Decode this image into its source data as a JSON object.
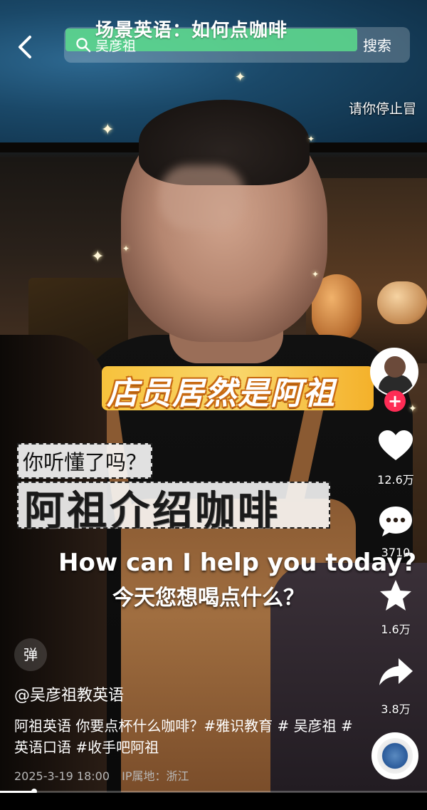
{
  "top": {
    "video_title": "场景英语：如何点咖啡",
    "search_query": "吴彦祖",
    "search_button": "搜索",
    "ticker_text": "请你停止冒"
  },
  "overlay": {
    "banner": "店员居然是阿祖",
    "caption_small": "你听懂了吗？",
    "caption_large": "阿祖介绍咖啡",
    "subtitle_en": "How can I help you today?",
    "subtitle_zh": "今天您想喝点什么？"
  },
  "actions": {
    "follow_symbol": "+",
    "likes": "12.6万",
    "comments": "3710",
    "favorites": "1.6万",
    "shares": "3.8万"
  },
  "info": {
    "danmu_label": "弹",
    "author": "@吴彦祖教英语",
    "description": "阿祖英语 你要点杯什么咖啡？#雅识教育 # 吴彦祖 #英语口语 #收手吧阿祖",
    "date": "2025-3-19 18:00",
    "ip_location": "IP属地：浙江"
  },
  "playback": {
    "progress_fraction": 0.08
  },
  "colors": {
    "follow_red": "#fe2c55",
    "banner_yellow": "#f7c23c",
    "search_highlight": "#5adc8c"
  },
  "icons": [
    "back-arrow-icon",
    "search-icon",
    "heart-icon",
    "comment-icon",
    "star-icon",
    "share-icon",
    "music-disc-icon"
  ]
}
